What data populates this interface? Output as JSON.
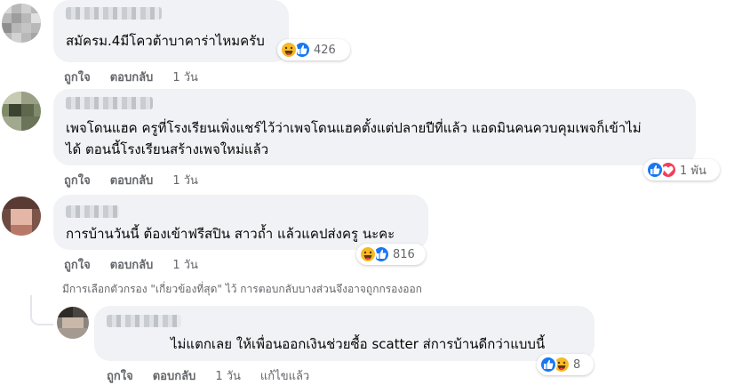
{
  "comments": [
    {
      "text": "สมัครม.4มีโควต้าบาคาร่าไหมครับ",
      "reaction_count": "426",
      "actions": {
        "like": "ถูกใจ",
        "reply": "ตอบกลับ",
        "time": "1 วัน"
      }
    },
    {
      "text_line1": "เพจโดนแฮค ครูที่โรงเรียนเพิ่งแชร์ไว้ว่าเพจโดนแฮคตั้งแต่ปลายปีที่แล้ว แอดมินคนควบคุมเพจก็เข้าไม่",
      "text_line2": "ได้ ตอนนี้โรงเรียนสร้างเพจใหม่แล้ว",
      "reaction_count": "1 พัน",
      "actions": {
        "like": "ถูกใจ",
        "reply": "ตอบกลับ",
        "time": "1 วัน"
      }
    },
    {
      "text": "การบ้านวันนี้ ต้องเข้าฟรีสปิน สาวถ้ำ แล้วแคปส่งครู นะคะ",
      "reaction_count": "816",
      "actions": {
        "like": "ถูกใจ",
        "reply": "ตอบกลับ",
        "time": "1 วัน"
      }
    }
  ],
  "filter_note": "มีการเลือกตัวกรอง \"เกี่ยวข้องที่สุด\" ไว้ การตอบกลับบางส่วนจึงอาจถูกกรองออก",
  "reply": {
    "text": "ไม่แตกเลย ให้เพื่อนออกเงินช่วยซื้อ scatter ส่การบ้านดีกว่าแบบนี้",
    "reaction_count": "8",
    "actions": {
      "like": "ถูกใจ",
      "reply": "ตอบกลับ",
      "time": "1 วัน",
      "edited": "แก้ไขแล้ว"
    }
  },
  "colors": {
    "like_blue": "#1877f2",
    "haha_yellow": "#f7b928",
    "love_red": "#f33e58",
    "bubble_bg": "#f0f2f5",
    "meta_gray": "#65676b"
  },
  "icons": [
    "haha-reaction-icon",
    "like-reaction-icon",
    "love-reaction-icon"
  ]
}
